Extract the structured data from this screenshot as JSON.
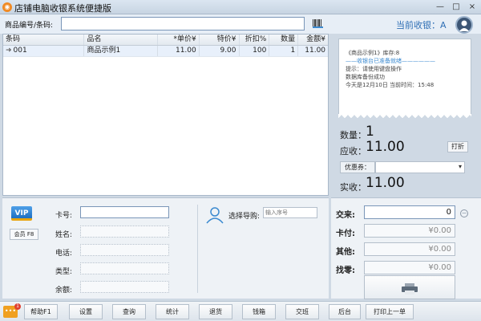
{
  "window": {
    "title": "店铺电脑收银系统便捷版",
    "controls": [
      "—",
      "□",
      "×"
    ]
  },
  "topbar": {
    "search_label": "商品编号/条码:",
    "search_value": "",
    "cashier_label": "当前收银：A"
  },
  "grid": {
    "columns": [
      "条码",
      "品名",
      "*单价¥",
      "特价¥",
      "折扣%",
      "数量",
      "金额¥"
    ],
    "rows": [
      {
        "barcode": "001",
        "name": "商品示例1",
        "price": "11.00",
        "special": "9.00",
        "discount": "100",
        "qty": "1",
        "amount": "11.00"
      }
    ]
  },
  "receipt": {
    "line1": "《商品示例1》库存:8",
    "line2": "——收银台已准备就绪——————",
    "line3": "提示：请使用键盘操作",
    "line4": "数据库备份成功",
    "line5": "今天是12月10日 当前时间：15:48"
  },
  "totals": {
    "qty_label": "数量：",
    "qty_value": "1",
    "due_label": "应收：",
    "due_value": "11.00",
    "print_label": "打折",
    "coupon_label": "优惠券：",
    "coupon_value": "",
    "paid_label": "实收：",
    "paid_value": "11.00"
  },
  "member": {
    "vip_text": "VIP",
    "member_button": "会员 F8",
    "card_label": "卡号:",
    "name_label": "姓名:",
    "phone_label": "电话:",
    "type_label": "类型:",
    "balance_label": "余额:",
    "guide_label": "选择导购:",
    "guide_placeholder": "输入序号"
  },
  "payments": {
    "cash_label": "交来:",
    "cash_value": "0",
    "card_label": "卡付:",
    "card_value": "¥0.00",
    "other_label": "其他:",
    "other_value": "¥0.00",
    "change_label": "找零:",
    "change_value": "¥0.00"
  },
  "bottombar": {
    "menu_badge": "1",
    "buttons": [
      "帮助F1",
      "设置",
      "查询",
      "统计",
      "退货",
      "钱箱",
      "交班",
      "后台",
      "打印上一单"
    ]
  },
  "colors": {
    "accent": "#2f6fb5",
    "vip": "#1d6fc2",
    "menu": "#f0a020"
  }
}
